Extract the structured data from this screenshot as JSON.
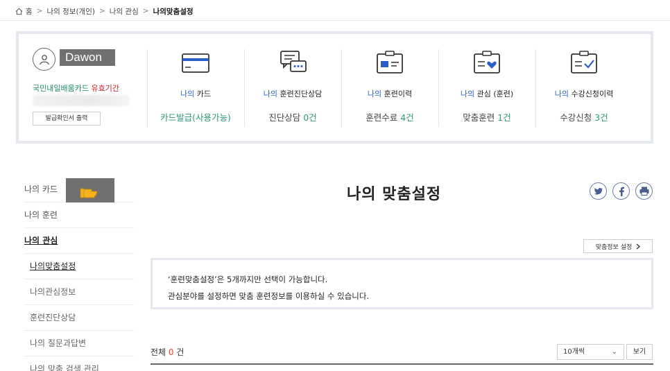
{
  "breadcrumb": {
    "home": "홈",
    "sep": ">",
    "level1": "나의 정보(개인)",
    "level2": "나의 관심",
    "current": "나의맞춤설정"
  },
  "profile": {
    "username": "Dawon",
    "card_label_prefix": "국민내일배움카드 ",
    "card_label_highlight": "유효기간",
    "print_button": "발급확인서 출력"
  },
  "stats": [
    {
      "icon": "card-icon",
      "mine": "나의",
      "title": " 카드",
      "value": "카드발급(사용가능)",
      "count": ""
    },
    {
      "icon": "chat-icon",
      "mine": "나의",
      "title": " 훈련진단상담",
      "value": "진단상담 ",
      "count": "0건"
    },
    {
      "icon": "id-card-icon",
      "mine": "나의",
      "title": " 훈련이력",
      "value": "훈련수료 ",
      "count": "4건"
    },
    {
      "icon": "heart-folder-icon",
      "mine": "나의",
      "title": " 관심 (훈련)",
      "value": "맞춤훈련 ",
      "count": "1건"
    },
    {
      "icon": "checklist-icon",
      "mine": "나의",
      "title": " 수강신청이력",
      "value": "수강신청 ",
      "count": "3건"
    }
  ],
  "sidebar": {
    "items": [
      {
        "label": "나의 카드"
      },
      {
        "label": "나의 훈련"
      },
      {
        "label": "나의 관심"
      },
      {
        "label": "나의맞춤설정"
      },
      {
        "label": "나의관심정보"
      },
      {
        "label": "훈련진단상담"
      },
      {
        "label": "나의 질문과답변"
      },
      {
        "label": "나의 맞춤 검색 관리"
      }
    ]
  },
  "main": {
    "title": "나의 맞춤설정",
    "setting_button": "맞춤정보 설정",
    "notice_line1": "‘훈련맞춤설정’은 5개까지만 선택이 가능합니다.",
    "notice_line2": "관심분야를 설정하면 맞춤 훈련정보를 이용하실 수 있습니다.",
    "total_label": "전체 ",
    "total_count": "0",
    "total_unit": " 건",
    "page_size": "10개씩",
    "view_button": "보기"
  },
  "colors": {
    "accent_blue": "#2b5fc7",
    "accent_green": "#2e9a78",
    "highlight_red": "#d0202a",
    "border": "#e6e8f0"
  }
}
